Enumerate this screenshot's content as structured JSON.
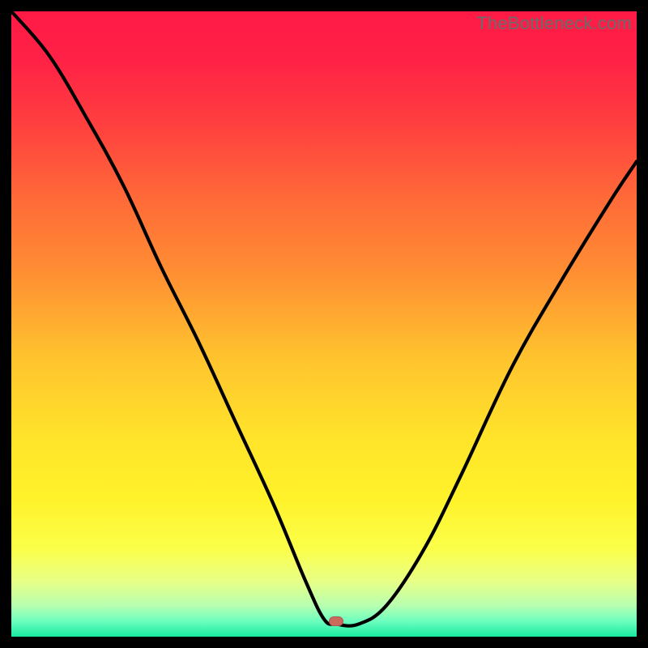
{
  "watermark": "TheBottleneck.com",
  "gradient_stops": [
    {
      "offset": 0.0,
      "color": "#ff1a46"
    },
    {
      "offset": 0.08,
      "color": "#ff2246"
    },
    {
      "offset": 0.18,
      "color": "#ff3f3f"
    },
    {
      "offset": 0.3,
      "color": "#ff6a38"
    },
    {
      "offset": 0.42,
      "color": "#ff8f33"
    },
    {
      "offset": 0.55,
      "color": "#ffc22e"
    },
    {
      "offset": 0.68,
      "color": "#ffe32a"
    },
    {
      "offset": 0.78,
      "color": "#fff22a"
    },
    {
      "offset": 0.86,
      "color": "#fbff4a"
    },
    {
      "offset": 0.91,
      "color": "#e9ff85"
    },
    {
      "offset": 0.95,
      "color": "#b8ffb0"
    },
    {
      "offset": 0.975,
      "color": "#6dffbf"
    },
    {
      "offset": 1.0,
      "color": "#19e9a0"
    }
  ],
  "marker": {
    "x_frac": 0.52,
    "y_frac": 0.975,
    "color": "#c96a5d"
  },
  "chart_data": {
    "type": "line",
    "title": "",
    "xlabel": "",
    "ylabel": "",
    "xlim": [
      0,
      1
    ],
    "ylim": [
      0,
      1
    ],
    "series": [
      {
        "name": "bottleneck-curve",
        "x": [
          0.0,
          0.06,
          0.12,
          0.18,
          0.24,
          0.3,
          0.36,
          0.42,
          0.47,
          0.5,
          0.52,
          0.555,
          0.6,
          0.66,
          0.72,
          0.8,
          0.88,
          0.96,
          1.0
        ],
        "y": [
          1.0,
          0.93,
          0.83,
          0.72,
          0.59,
          0.47,
          0.34,
          0.21,
          0.09,
          0.028,
          0.02,
          0.02,
          0.05,
          0.14,
          0.26,
          0.43,
          0.57,
          0.7,
          0.76
        ]
      }
    ],
    "annotations": [
      {
        "type": "marker",
        "x": 0.52,
        "y": 0.022
      }
    ]
  }
}
